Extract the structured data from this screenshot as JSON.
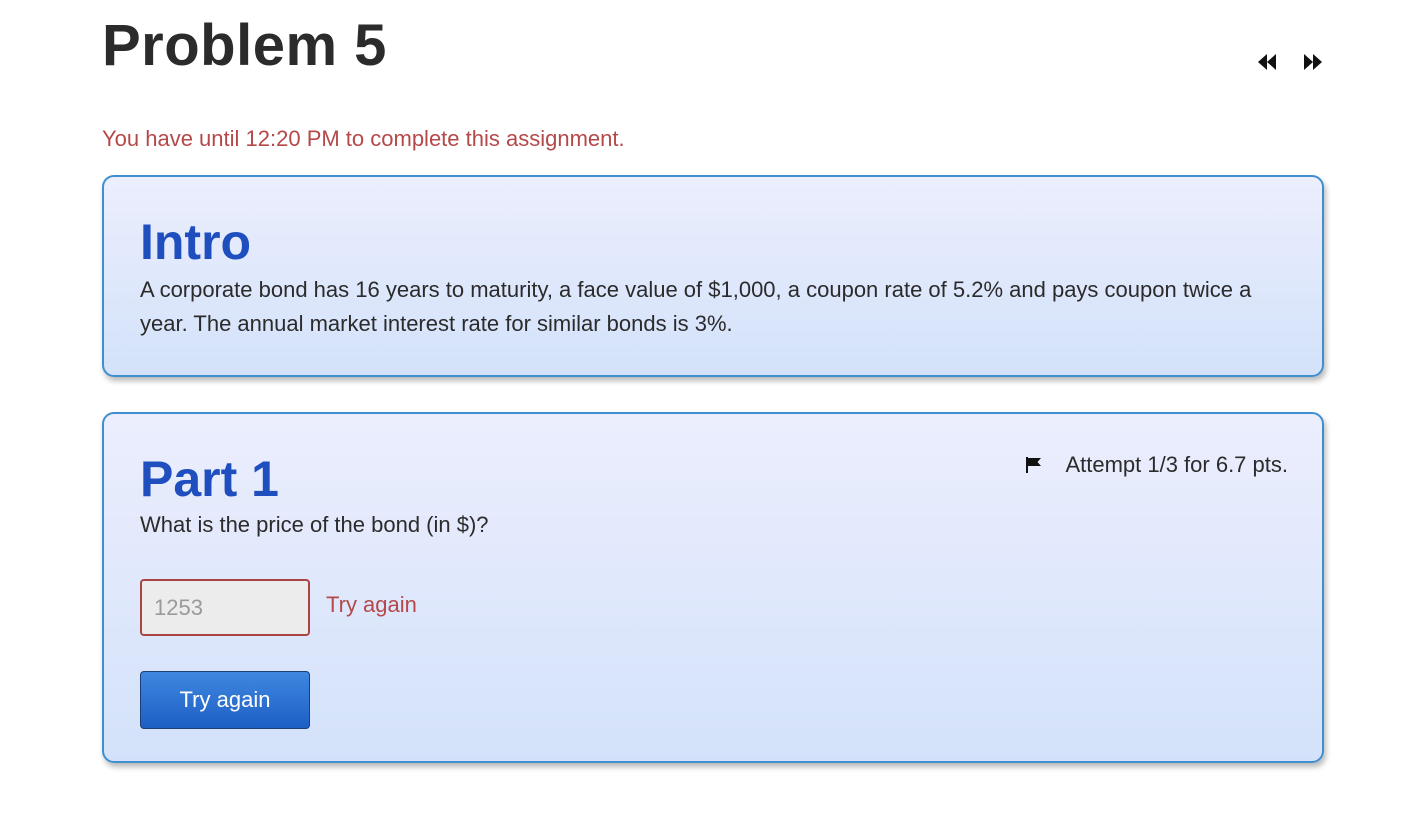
{
  "header": {
    "title": "Problem 5",
    "prev_icon": "double-chevron-left-icon",
    "next_icon": "double-chevron-right-icon"
  },
  "deadline_text": "You have until 12:20 PM to complete this assignment.",
  "intro": {
    "heading": "Intro",
    "text": "A corporate bond has 16 years to maturity, a face value of $1,000, a coupon rate of 5.2% and pays coupon twice a year. The annual market interest rate for similar bonds is 3%."
  },
  "part1": {
    "heading": "Part 1",
    "flag_icon": "flag-icon",
    "attempt_text": "Attempt 1/3 for 6.7 pts.",
    "question": "What is the price of the bond (in $)?",
    "answer_value": "1253",
    "feedback": "Try again",
    "submit_label": "Try again"
  },
  "colors": {
    "heading_blue": "#1f4fbf",
    "deadline_red": "#b5494a",
    "card_border": "#3f8fd0",
    "button_blue": "#1d5fc4"
  }
}
